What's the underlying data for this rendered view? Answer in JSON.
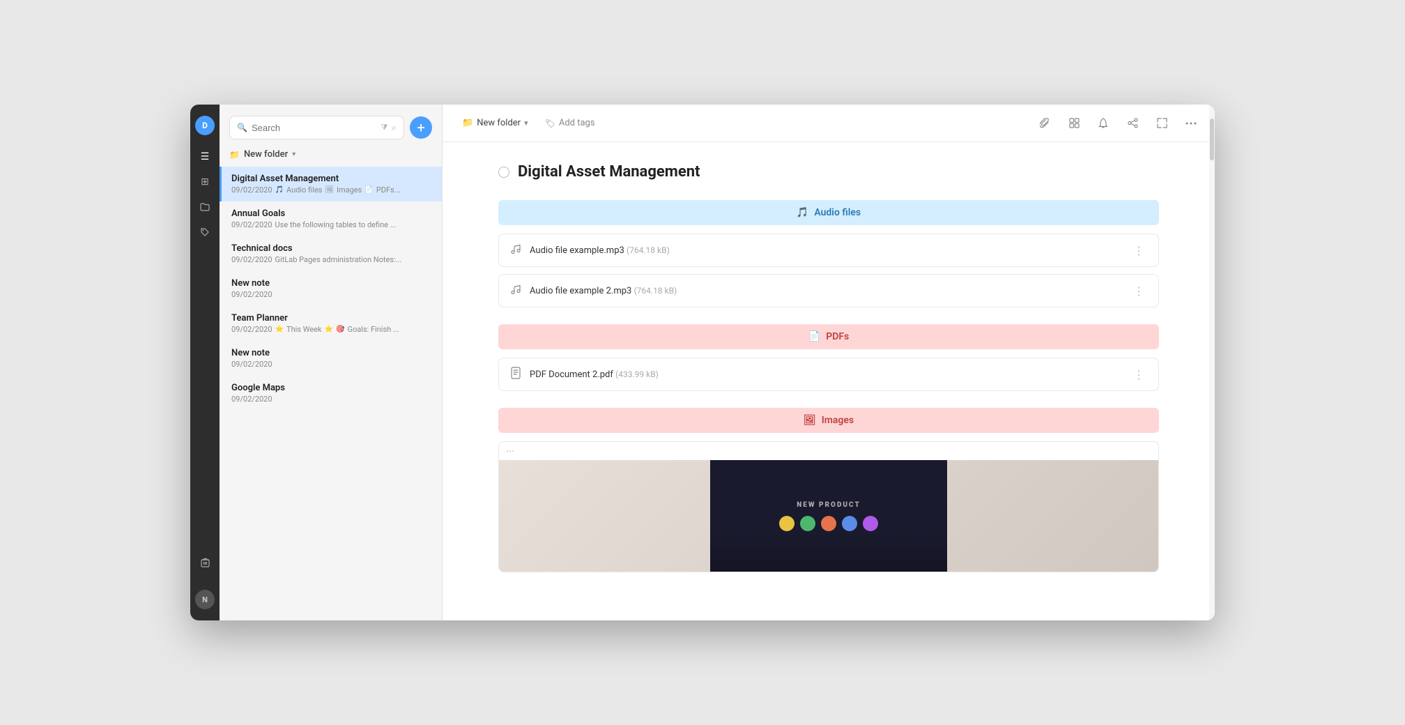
{
  "window": {
    "title": "Notes App"
  },
  "icon_sidebar": {
    "top_avatar": "D",
    "bottom_avatar": "N",
    "icons": [
      {
        "name": "hamburger-menu-icon",
        "symbol": "☰",
        "active": true
      },
      {
        "name": "grid-icon",
        "symbol": "⊞"
      },
      {
        "name": "folder-icon",
        "symbol": "📁"
      },
      {
        "name": "tag-icon",
        "symbol": "🏷"
      },
      {
        "name": "trash-icon",
        "symbol": "🗑"
      }
    ]
  },
  "notes_sidebar": {
    "search_placeholder": "Search",
    "add_button_label": "+",
    "folder_label": "New folder",
    "notes": [
      {
        "title": "Digital Asset Management",
        "date": "09/02/2020",
        "preview": "🎵 Audio files 🖼 Images 📄 PDFs...",
        "active": true
      },
      {
        "title": "Annual Goals",
        "date": "09/02/2020",
        "preview": "Use the following tables to define ..."
      },
      {
        "title": "Technical docs",
        "date": "09/02/2020",
        "preview": "GitLab Pages administration Notes:..."
      },
      {
        "title": "New note",
        "date": "09/02/2020",
        "preview": ""
      },
      {
        "title": "Team Planner",
        "date": "09/02/2020",
        "preview": "⭐ This Week ⭐ 🎯 Goals: Finish ..."
      },
      {
        "title": "New note",
        "date": "09/02/2020",
        "preview": ""
      },
      {
        "title": "Google Maps",
        "date": "09/02/2020",
        "preview": ""
      }
    ]
  },
  "toolbar": {
    "folder_label": "New folder",
    "folder_chevron": "▾",
    "tag_label": "Add tags",
    "icons": [
      {
        "name": "paperclip-icon",
        "symbol": "📎"
      },
      {
        "name": "grid-view-icon",
        "symbol": "⊞"
      },
      {
        "name": "bell-icon",
        "symbol": "🔔"
      },
      {
        "name": "share-icon",
        "symbol": "⤢"
      },
      {
        "name": "expand-icon",
        "symbol": "⛶"
      },
      {
        "name": "more-options-icon",
        "symbol": "⋯"
      }
    ]
  },
  "document": {
    "title": "Digital Asset Management",
    "sections": [
      {
        "type": "audio",
        "label": "Audio files",
        "icon": "🎵",
        "files": [
          {
            "name": "Audio file example.mp3",
            "size": "764.18 kB"
          },
          {
            "name": "Audio file example 2.mp3",
            "size": "764.18 kB"
          }
        ]
      },
      {
        "type": "pdfs",
        "label": "PDFs",
        "icon": "📄",
        "files": [
          {
            "name": "PDF Document 2.pdf",
            "size": "433.99 kB"
          }
        ]
      },
      {
        "type": "images",
        "label": "Images",
        "icon": "🖼",
        "files": []
      }
    ],
    "image_preview": {
      "label": "NEW PRODUCT",
      "dots": [
        {
          "color": "#e8c440"
        },
        {
          "color": "#4cb86e"
        },
        {
          "color": "#e8734a"
        },
        {
          "color": "#5b8de8"
        },
        {
          "color": "#b05be8"
        }
      ]
    }
  }
}
